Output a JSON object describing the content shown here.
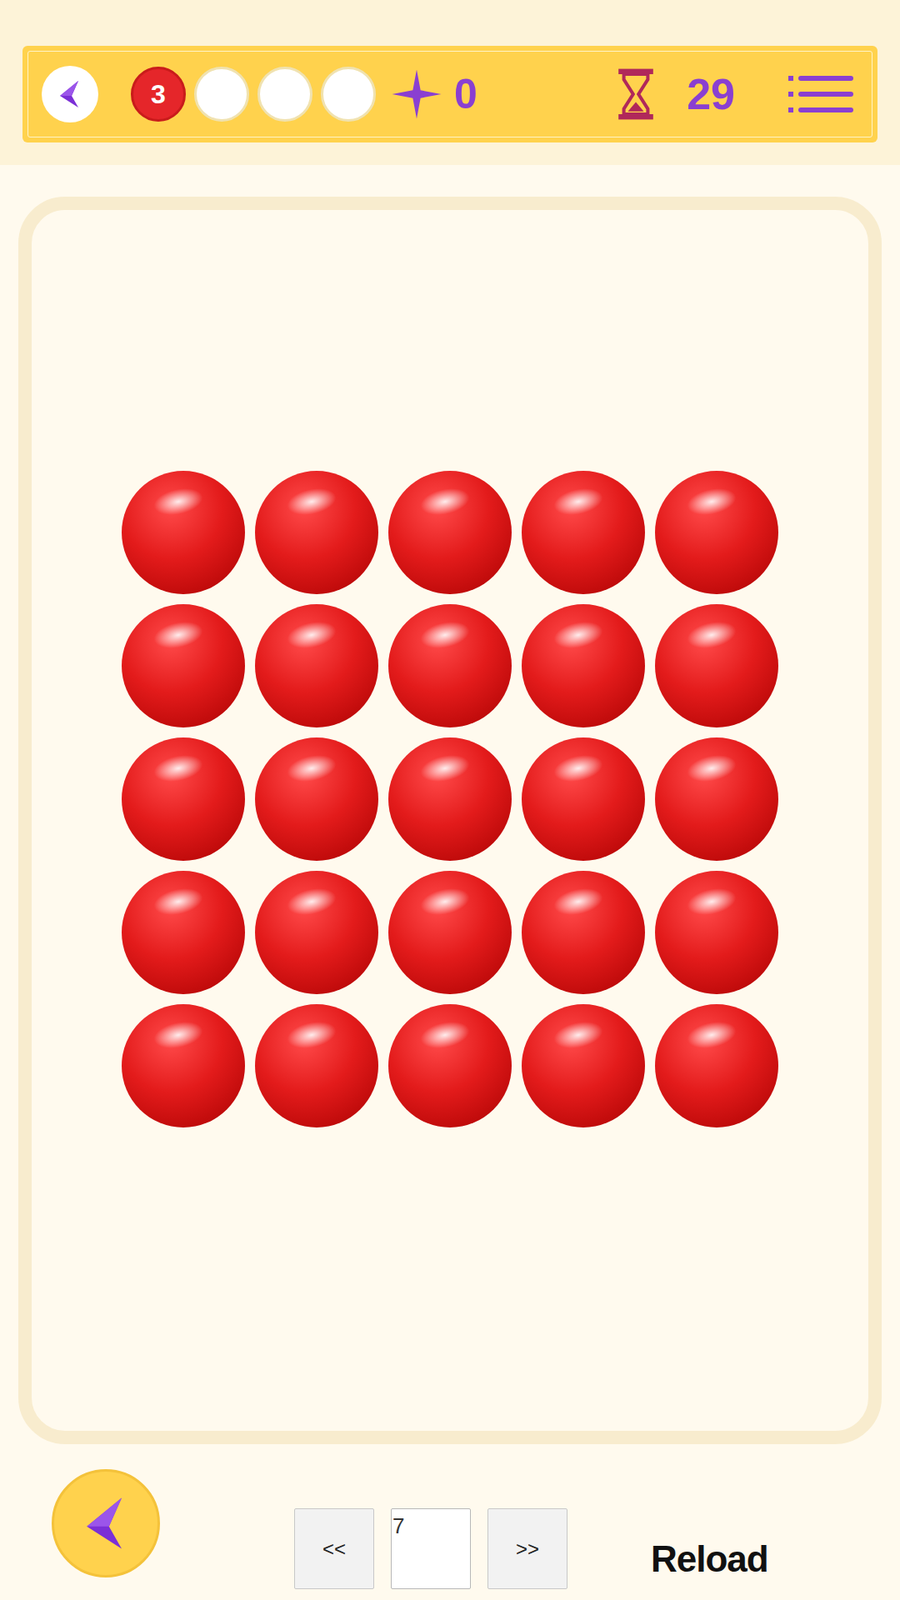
{
  "header": {
    "progress": [
      {
        "text": "3",
        "filled": true,
        "color": "#e5262a"
      },
      {
        "text": "",
        "filled": false,
        "color": "#ffffff"
      },
      {
        "text": "",
        "filled": false,
        "color": "#ffffff"
      },
      {
        "text": "",
        "filled": false,
        "color": "#ffffff"
      }
    ],
    "stars": "0",
    "timer": "29"
  },
  "board": {
    "rows": [
      [
        {
          "color": "#e31b1b"
        },
        {
          "color": "#e31b1b"
        },
        {
          "color": "#e31b1b"
        },
        {
          "color": "#e31b1b"
        },
        {
          "color": "#e31b1b"
        }
      ],
      [
        {
          "color": "#e31b1b"
        },
        {
          "color": "#e31b1b"
        },
        {
          "color": "#e31b1b"
        },
        {
          "color": "#e31b1b"
        },
        {
          "color": "#e31b1b"
        }
      ],
      [
        {
          "color": "#e31b1b"
        },
        {
          "color": "#e31b1b"
        },
        {
          "color": "#e31b1b"
        },
        {
          "color": "#e31b1b"
        },
        {
          "color": "#e31b1b"
        }
      ],
      [
        {
          "color": "#e31b1b"
        },
        {
          "color": "#e31b1b"
        },
        {
          "color": "#e31b1b"
        },
        {
          "color": "#e31b1b"
        },
        {
          "color": "#e31b1b"
        }
      ],
      [
        {
          "color": "#e31b1b"
        },
        {
          "color": "#e31b1b"
        },
        {
          "color": "#e31b1b"
        },
        {
          "color": "#e31b1b"
        },
        {
          "color": "#e31b1b"
        }
      ]
    ]
  },
  "footer": {
    "prev": "<<",
    "page": "7",
    "next": ">>",
    "reload": "Reload"
  }
}
